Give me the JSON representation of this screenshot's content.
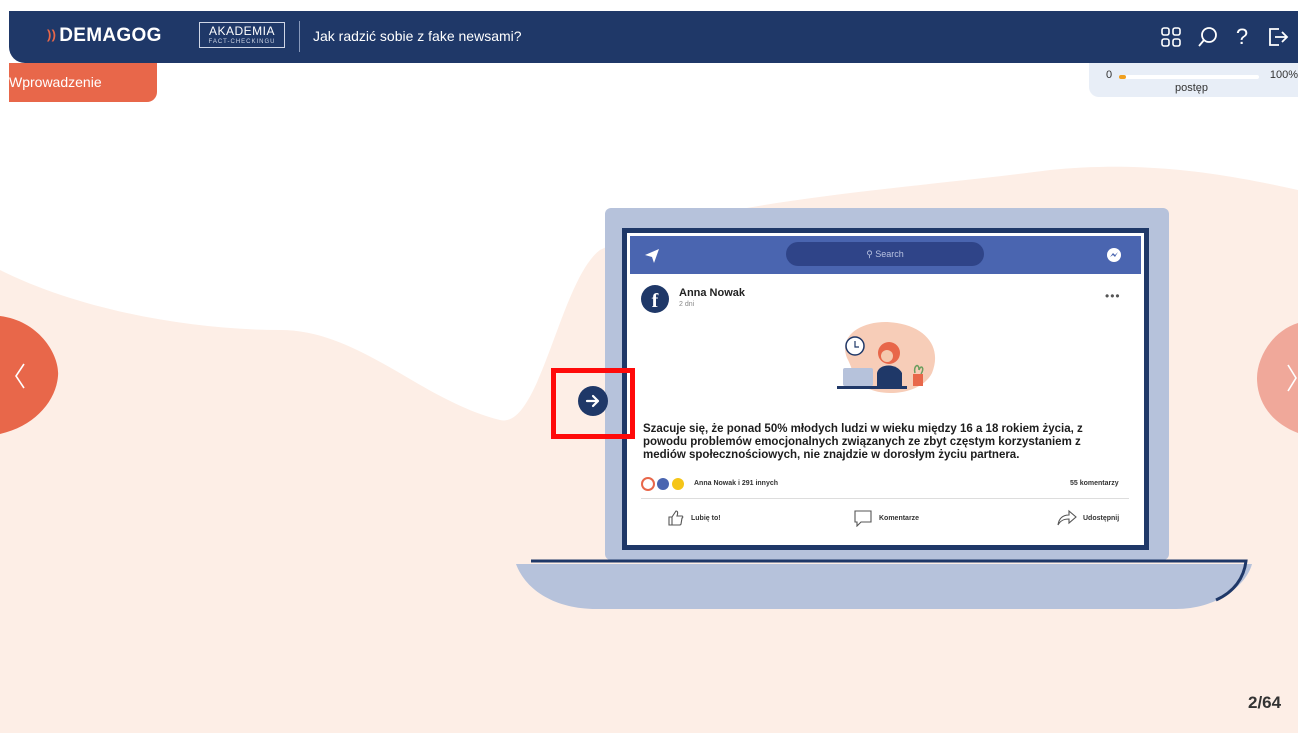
{
  "header": {
    "brand": "DEMAGOG",
    "akademia_line1": "AKADEMIA",
    "akademia_line2": "FACT-CHECKINGU",
    "course_title": "Jak radzić sobie z fake newsami?",
    "icons": [
      "grid-icon",
      "search-icon",
      "help-icon",
      "exit-icon"
    ],
    "help_glyph": "?"
  },
  "section_tab": {
    "label": "Wprowadzenie"
  },
  "progress": {
    "min_label": "0",
    "max_label": "100%",
    "label": "postęp",
    "value": 0.05
  },
  "post": {
    "search_placeholder": "Search",
    "avatar_letter": "f",
    "author": "Anna Nowak",
    "time": "2 dni",
    "more": "•••",
    "text": "Szacuje się, że ponad 50% młodych ludzi w wieku między 16 a 18 rokiem życia, z powodu problemów emocjonalnych związanych ze zbyt częstym korzystaniem z mediów społecznościowych, nie znajdzie w dorosłym życiu partnera.",
    "reaction_names": "Anna Nowak i 291 innych",
    "comments": "55 komentarzy",
    "actions": {
      "like": "Lubię to!",
      "comment": "Komentarze",
      "share": "Udostępnij"
    }
  },
  "page_indicator": "2/64",
  "colors": {
    "navy": "#1f3868",
    "accent": "#e8674a",
    "background_shape": "#fdeee6",
    "progress_fill": "#f0a020",
    "highlight": "#ff0a0a"
  }
}
